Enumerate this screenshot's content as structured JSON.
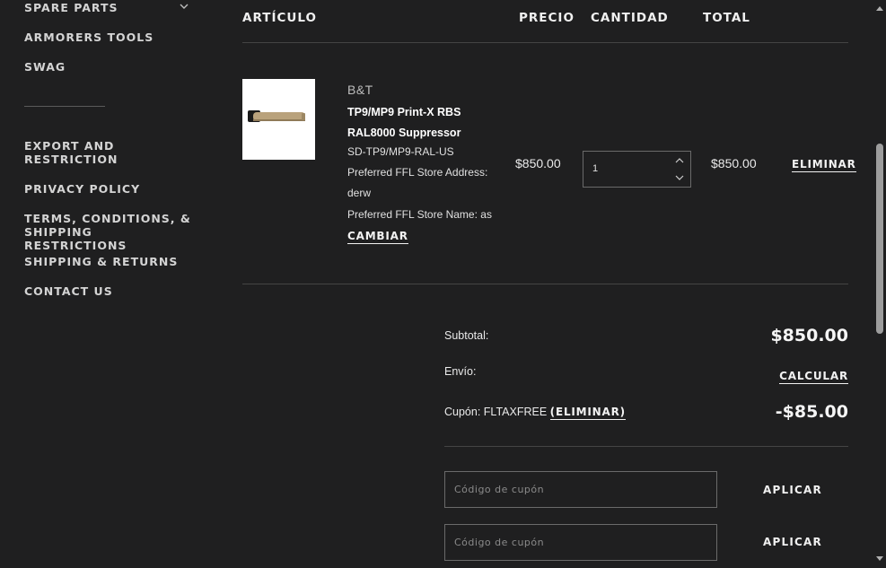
{
  "sidebar": {
    "items": [
      {
        "label": "SPARE PARTS"
      },
      {
        "label": "ARMORERS TOOLS"
      },
      {
        "label": "SWAG"
      },
      {
        "label": "EXPORT AND RESTRICTION"
      },
      {
        "label": "PRIVACY POLICY"
      },
      {
        "label": "TERMS, CONDITIONS, & SHIPPING RESTRICTIONS"
      },
      {
        "label": "SHIPPING & RETURNS"
      },
      {
        "label": "CONTACT US"
      }
    ],
    "expand_icon": "chevron-down-icon"
  },
  "table": {
    "headers": {
      "article": "ARTÍCULO",
      "price": "PRECIO",
      "quantity": "CANTIDAD",
      "total": "TOTAL"
    }
  },
  "item": {
    "brand": "B&T",
    "name": "TP9/MP9 Print-X RBS RAL8000 Suppressor",
    "sku": "SD-TP9/MP9-RAL-US",
    "ffl_address_label": "Preferred FFL Store Address:",
    "ffl_address_value": "derw",
    "ffl_name": "Preferred FFL Store Name: as",
    "change_label": "CAMBIAR",
    "price": "$850.00",
    "quantity": "1",
    "total": "$850.00",
    "remove_label": "ELIMINAR",
    "product_color": "#b9a27c"
  },
  "totals": {
    "subtotal_label": "Subtotal:",
    "subtotal_value": "$850.00",
    "shipping_label": "Envío:",
    "shipping_action": "CALCULAR",
    "coupon_label": "Cupón: FLTAXFREE",
    "coupon_remove": "(ELIMINAR)",
    "coupon_value": "-$85.00"
  },
  "coupon_forms": [
    {
      "placeholder": "Código de cupón",
      "button": "APLICAR"
    },
    {
      "placeholder": "Código de cupón",
      "button": "APLICAR"
    }
  ],
  "colors": {
    "background": "#1f1f20",
    "text": "#e8e8e8",
    "divider": "#444444"
  }
}
